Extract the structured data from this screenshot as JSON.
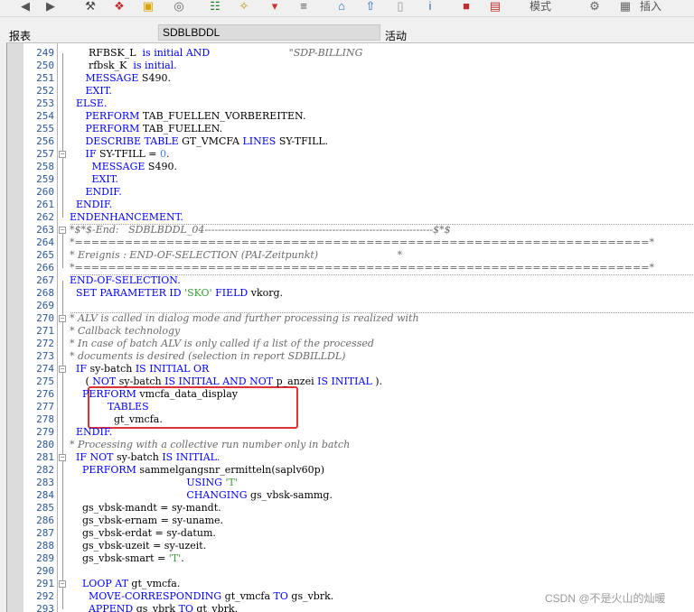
{
  "toolbar": {
    "icons": [
      "back-icon",
      "forward-icon",
      "tools-icon",
      "objects-icon",
      "copy-icon",
      "display-icon",
      "hierarchy-icon",
      "magic-icon",
      "pin-icon",
      "tree-icon",
      "transport-icon",
      "upload-icon",
      "document-icon",
      "info-icon",
      "pattern-icon",
      "pretty-icon",
      "settings-icon",
      "insert-icon"
    ],
    "mode_label": "模式",
    "insert_label": "插入"
  },
  "infobar": {
    "type_label": "报表",
    "program_name": "SDBLBDDL",
    "status_label": "活动"
  },
  "code_lines": [
    {
      "n": "249",
      "h": "      RFBSK_L  <span class=\"kw\">is initial AND</span>                         <span class=\"cm\">\"SDP-BILLING</span>"
    },
    {
      "n": "250",
      "h": "      rfbsk_K  <span class=\"kw\">is initial.</span>"
    },
    {
      "n": "251",
      "h": "     <span class=\"kw\">MESSAGE</span> S490."
    },
    {
      "n": "252",
      "h": "     <span class=\"kw\">EXIT.</span>"
    },
    {
      "n": "253",
      "h": "  <span class=\"kw\">ELSE.</span>"
    },
    {
      "n": "254",
      "h": "     <span class=\"kw\">PERFORM</span> TAB_FUELLEN_VORBEREITEN."
    },
    {
      "n": "255",
      "h": "     <span class=\"kw\">PERFORM</span> TAB_FUELLEN."
    },
    {
      "n": "256",
      "h": "     <span class=\"kw\">DESCRIBE TABLE</span> GT_VMCFA <span class=\"kw\">LINES</span> SY-TFILL."
    },
    {
      "n": "257",
      "h": "     <span class=\"kw\">IF</span> SY-TFILL = <span class=\"nu\">0</span>."
    },
    {
      "n": "258",
      "h": "       <span class=\"kw\">MESSAGE</span> S490."
    },
    {
      "n": "259",
      "h": "       <span class=\"kw\">EXIT.</span>"
    },
    {
      "n": "260",
      "h": "     <span class=\"kw\">ENDIF.</span>"
    },
    {
      "n": "261",
      "h": "  <span class=\"kw\">ENDIF.</span>"
    },
    {
      "n": "262",
      "h": "<span class=\"kw\">ENDENHANCEMENT.</span>"
    },
    {
      "n": "263",
      "h": "<span class=\"cm\">*$*$-End:   SDBLBDDL_04--------------------------------------------------------------------$*$</span>"
    },
    {
      "n": "264",
      "h": "<span class=\"cm\">*=====================================================================*</span>"
    },
    {
      "n": "265",
      "h": "<span class=\"cm\">* Ereignis : END-OF-SELECTION (PAI-Zeitpunkt)                         *</span>"
    },
    {
      "n": "266",
      "h": "<span class=\"cm\">*=====================================================================*</span>"
    },
    {
      "n": "267",
      "h": "<span class=\"kw\">END-OF-SELECTION.</span>"
    },
    {
      "n": "268",
      "h": "  <span class=\"kw\">SET PARAMETER ID</span> <span class=\"st\">'SKO'</span> <span class=\"kw\">FIELD</span> vkorg."
    },
    {
      "n": "269",
      "h": ""
    },
    {
      "n": "270",
      "h": "<span class=\"cm\">* ALV is called in dialog mode and further processing is realized with</span>"
    },
    {
      "n": "271",
      "h": "<span class=\"cm\">* Callback technology</span>"
    },
    {
      "n": "272",
      "h": "<span class=\"cm\">* In case of batch ALV is only called if a list of the processed</span>"
    },
    {
      "n": "273",
      "h": "<span class=\"cm\">* documents is desired (selection in report SDBILLDL)</span>"
    },
    {
      "n": "274",
      "h": "  <span class=\"kw\">IF</span> sy-batch <span class=\"kw\">IS INITIAL OR</span>"
    },
    {
      "n": "275",
      "h": "     ( <span class=\"kw\">NOT</span> sy-batch <span class=\"kw\">IS INITIAL AND NOT</span> p_anzei <span class=\"kw\">IS INITIAL</span> )."
    },
    {
      "n": "276",
      "h": "    <span class=\"kw\">PERFORM</span> vmcfa_data_display"
    },
    {
      "n": "277",
      "h": "            <span class=\"kw\">TABLES</span>"
    },
    {
      "n": "278",
      "h": "              gt_vmcfa."
    },
    {
      "n": "279",
      "h": "  <span class=\"kw\">ENDIF.</span>"
    },
    {
      "n": "280",
      "h": "<span class=\"cm\">* Processing with a collective run number only in batch</span>"
    },
    {
      "n": "281",
      "h": "  <span class=\"kw\">IF NOT</span> sy-batch <span class=\"kw\">IS INITIAL.</span>"
    },
    {
      "n": "282",
      "h": "    <span class=\"kw\">PERFORM</span> sammelgangsnr_ermitteln(saplv60p)"
    },
    {
      "n": "283",
      "h": "                                     <span class=\"kw\">USING</span> <span class=\"st\">'T'</span>"
    },
    {
      "n": "284",
      "h": "                                     <span class=\"kw\">CHANGING</span> gs_vbsk-sammg."
    },
    {
      "n": "285",
      "h": "    gs_vbsk-mandt = sy-mandt."
    },
    {
      "n": "286",
      "h": "    gs_vbsk-ernam = sy-uname."
    },
    {
      "n": "287",
      "h": "    gs_vbsk-erdat = sy-datum."
    },
    {
      "n": "288",
      "h": "    gs_vbsk-uzeit = sy-uzeit."
    },
    {
      "n": "289",
      "h": "    gs_vbsk-smart = <span class=\"st\">'T'</span>."
    },
    {
      "n": "290",
      "h": ""
    },
    {
      "n": "291",
      "h": "    <span class=\"kw\">LOOP AT</span> gt_vmcfa."
    },
    {
      "n": "292",
      "h": "      <span class=\"kw\">MOVE-CORRESPONDING</span> gt_vmcfa <span class=\"kw\">TO</span> gs_vbrk."
    },
    {
      "n": "293",
      "h": "      <span class=\"kw\">APPEND</span> gs_vbrk <span class=\"kw\">TO</span> gt_vbrk."
    }
  ],
  "watermark": "CSDN @不是火山的灿暖"
}
